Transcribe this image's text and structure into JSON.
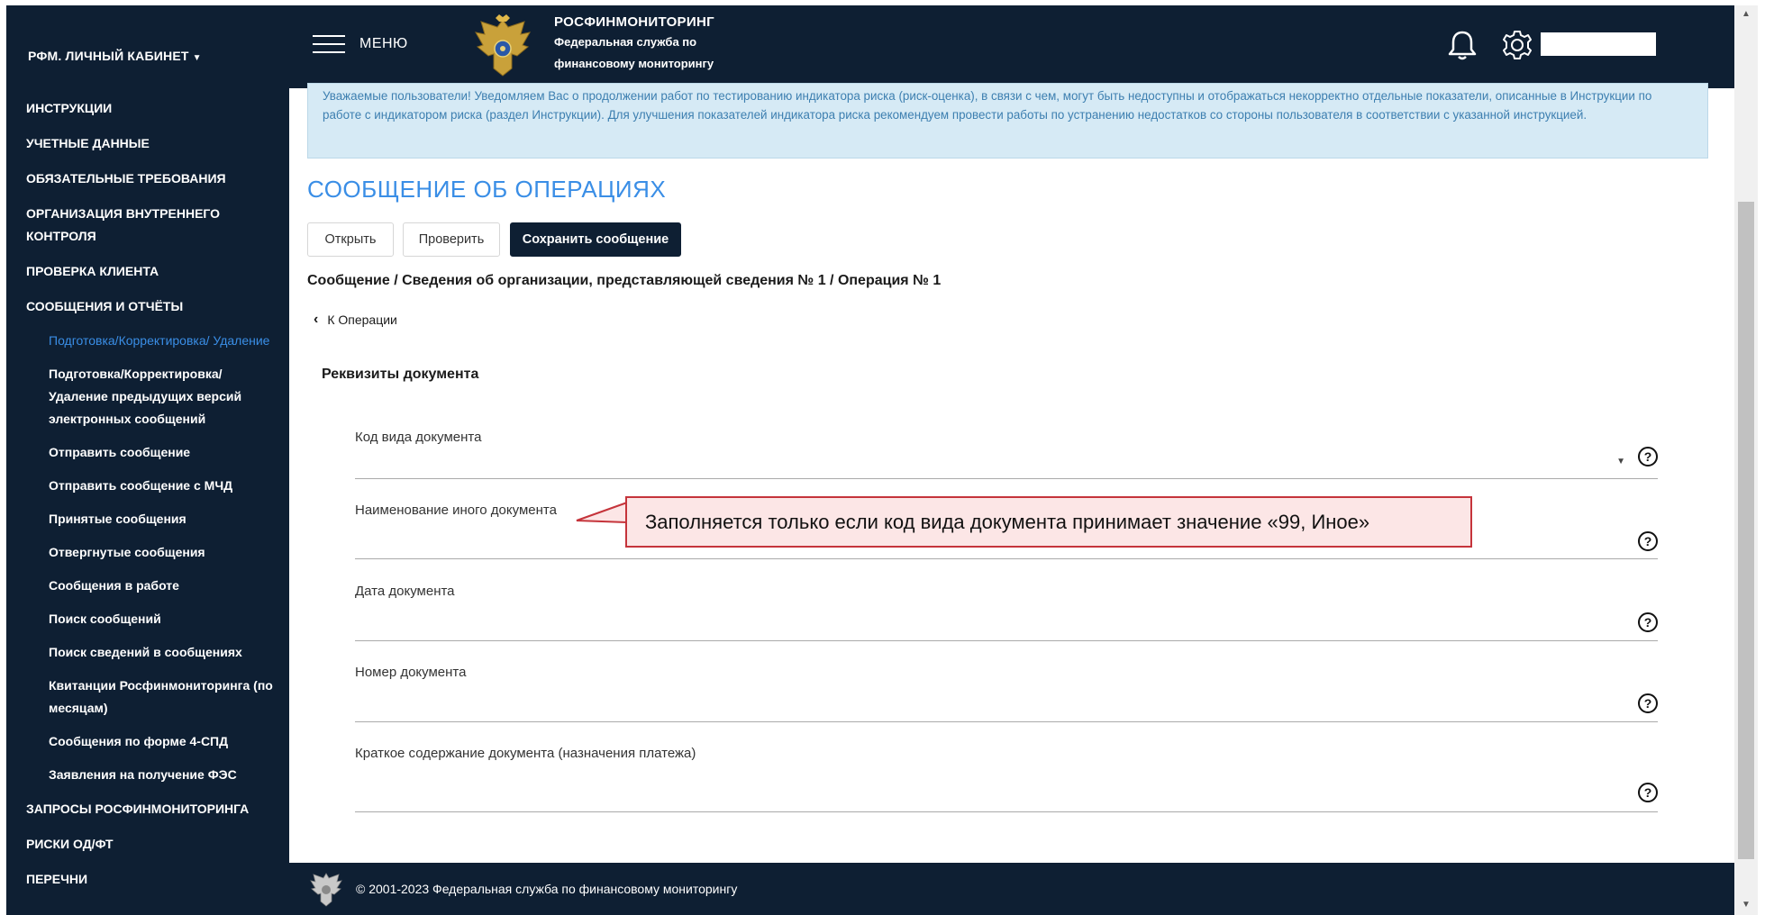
{
  "sidebar": {
    "cabinet_label": "РФМ. ЛИЧНЫЙ КАБИНЕТ",
    "items": [
      {
        "label": "ИНСТРУКЦИИ"
      },
      {
        "label": "УЧЕТНЫЕ ДАННЫЕ"
      },
      {
        "label": "ОБЯЗАТЕЛЬНЫЕ ТРЕБОВАНИЯ"
      },
      {
        "label": "ОРГАНИЗАЦИЯ ВНУТРЕННЕГО КОНТРОЛЯ"
      },
      {
        "label": "ПРОВЕРКА КЛИЕНТА"
      },
      {
        "label": "СООБЩЕНИЯ И ОТЧЁТЫ"
      }
    ],
    "sub_items": [
      {
        "label": "Подготовка/Корректировка/ Удаление"
      },
      {
        "label": "Подготовка/Корректировка/ Удаление предыдущих версий электронных сообщений"
      },
      {
        "label": "Отправить сообщение"
      },
      {
        "label": "Отправить сообщение с МЧД"
      },
      {
        "label": "Принятые сообщения"
      },
      {
        "label": "Отвергнутые сообщения"
      },
      {
        "label": "Сообщения в работе"
      },
      {
        "label": "Поиск сообщений"
      },
      {
        "label": "Поиск сведений в сообщениях"
      },
      {
        "label": "Квитанции Росфинмониторинга (по месяцам)"
      },
      {
        "label": "Сообщения по форме 4-СПД"
      },
      {
        "label": "Заявления на получение ФЭС"
      }
    ],
    "bottom_items": [
      {
        "label": "ЗАПРОСЫ РОСФИНМОНИТОРИНГА"
      },
      {
        "label": "РИСКИ ОД/ФТ"
      },
      {
        "label": "ПЕРЕЧНИ"
      }
    ]
  },
  "header": {
    "menu_label": "МЕНЮ",
    "brand_title": "РОСФИНМОНИТОРИНГ",
    "brand_line1": "Федеральная служба по",
    "brand_line2": "финансовому мониторингу"
  },
  "notice": {
    "text": "Уважаемые пользователи! Уведомляем Вас о продолжении работ по тестированию индикатора риска (риск-оценка), в связи с чем, могут быть недоступны и отображаться некорректно отдельные показатели, описанные в Инструкции по работе с индикатором риска (раздел Инструкции). Для улучшения показателей индикатора риска рекомендуем провести работы по устранению недостатков со стороны пользователя в соответствии с указанной инструкцией."
  },
  "main": {
    "title": "СООБЩЕНИЕ ОБ ОПЕРАЦИЯХ",
    "buttons": {
      "open": "Открыть",
      "check": "Проверить",
      "save": "Сохранить сообщение"
    },
    "breadcrumb": "Сообщение / Сведения об организации, представляющей сведения № 1 / Операция № 1",
    "back_link": "К Операции",
    "section_title": "Реквизиты документа",
    "fields": [
      {
        "label": "Код вида документа",
        "value": ""
      },
      {
        "label": "Наименование иного документа",
        "value": ""
      },
      {
        "label": "Дата документа",
        "value": ""
      },
      {
        "label": "Номер документа",
        "value": ""
      },
      {
        "label": "Краткое содержание документа (назначения платежа)",
        "value": ""
      }
    ],
    "help_symbol": "?",
    "callout": "Заполняется только если код вида документа принимает значение «99, Иное»"
  },
  "footer": {
    "text": "© 2001-2023 Федеральная служба по финансовому мониторингу"
  },
  "colors": {
    "navy": "#0e1f33",
    "accent_blue": "#3a8ee6",
    "notice_bg": "#d6eaf5",
    "callout_border": "#c5343b"
  }
}
